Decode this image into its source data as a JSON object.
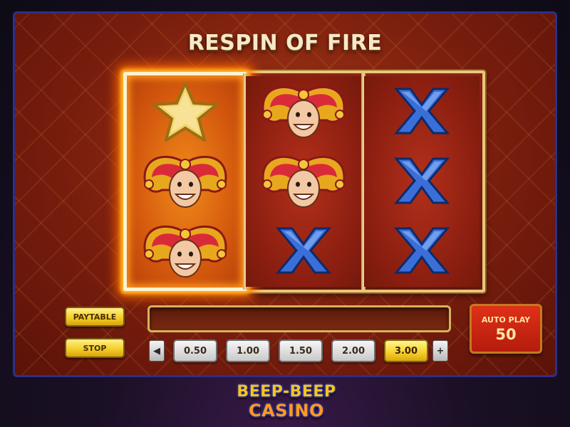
{
  "game": {
    "title": "RESPIN OF FIRE",
    "reels": [
      {
        "on_fire": true,
        "symbols": [
          "star",
          "jester",
          "jester"
        ]
      },
      {
        "on_fire": false,
        "symbols": [
          "jester",
          "jester",
          "x"
        ]
      },
      {
        "on_fire": false,
        "symbols": [
          "x",
          "x",
          "x"
        ]
      }
    ]
  },
  "controls": {
    "paytable_label": "PAYTABLE",
    "stop_label": "STOP",
    "message": "",
    "bet_decrease_icon": "triangle-left-icon",
    "bet_increase_icon": "plus-icon",
    "bets": [
      "0.50",
      "1.00",
      "1.50",
      "2.00",
      "3.00"
    ],
    "selected_bet": "3.00",
    "auto_play_label": "AUTO PLAY",
    "auto_play_count": "50"
  },
  "branding": {
    "logo_line1": "BEEP-BEEP",
    "logo_line2": "CASINO"
  },
  "colors": {
    "frame_border": "#2c2f8a",
    "reel_gold": "#e7c77a",
    "fire_glow": "#ff6a00",
    "button_yellow": "#f4cf2a",
    "auto_play_red": "#d0281a",
    "x_blue": "#3a6fd8"
  }
}
